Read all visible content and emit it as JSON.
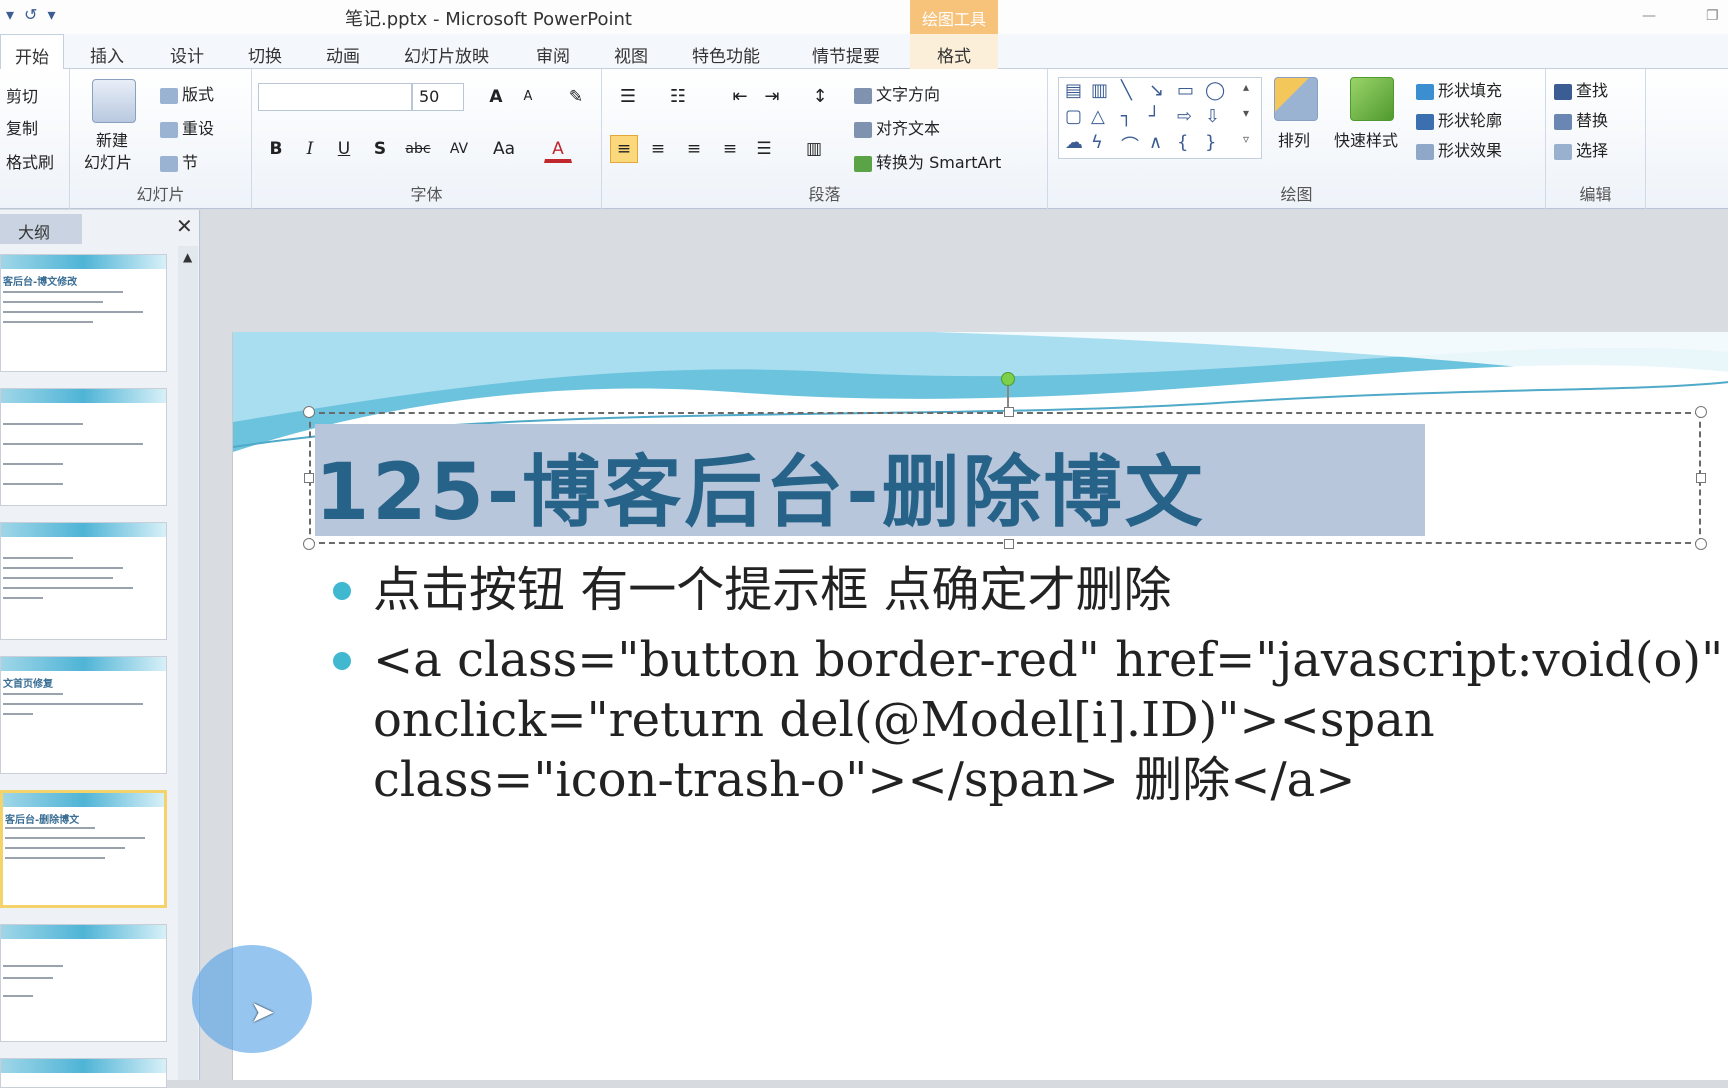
{
  "window": {
    "title": "笔记.pptx - Microsoft PowerPoint",
    "context_tab": "绘图工具",
    "qat_undo": "↺",
    "qat_menu": "▾",
    "minimize": "—",
    "restore": "❐"
  },
  "tabs": [
    "开始",
    "插入",
    "设计",
    "切换",
    "动画",
    "幻灯片放映",
    "审阅",
    "视图",
    "特色功能",
    "情节提要",
    "格式"
  ],
  "clipboard": {
    "cut": "剪切",
    "copy": "复制",
    "format_painter": "格式刷"
  },
  "slides_group": {
    "label": "幻灯片",
    "new_slide": "新建",
    "new_slide2": "幻灯片",
    "layout": "版式",
    "reset": "重设",
    "section": "节"
  },
  "font_group": {
    "label": "字体",
    "font_name": "",
    "font_size": "50",
    "bold": "B",
    "italic": "I",
    "underline": "U",
    "shadow": "S",
    "strike": "abc",
    "spacing": "AV",
    "case": "Aa",
    "color": "A",
    "grow": "A",
    "shrink": "A"
  },
  "paragraph_group": {
    "label": "段落",
    "text_direction": "文字方向",
    "align_text": "对齐文本",
    "smartart": "转换为 SmartArt"
  },
  "drawing_group": {
    "label": "绘图",
    "arrange": "排列",
    "quick_styles": "快速样式",
    "shape_fill": "形状填充",
    "shape_outline": "形状轮廓",
    "shape_effects": "形状效果"
  },
  "editing_group": {
    "label": "编辑",
    "find": "查找",
    "replace": "替换",
    "select": "选择"
  },
  "panel": {
    "tab": "大纲",
    "close": "✕"
  },
  "thumbnails": [
    {
      "title": "客后台-博文修改"
    },
    {
      "title": ""
    },
    {
      "title": ""
    },
    {
      "title": "文首页修复"
    },
    {
      "title": "客后台-删除博文"
    },
    {
      "title": ""
    }
  ],
  "slide": {
    "title": "125-博客后台-删除博文",
    "bullet1": "点击按钮 有一个提示框 点确定才删除",
    "bullet2_line1": "<a class=\"button border-red\" href=\"javascript:void(o)\"",
    "bullet2_line2": "onclick=\"return del(@Model[i].ID)\"><span",
    "bullet2_line3": "class=\"icon-trash-o\"></span> 删除</a>"
  },
  "colors": {
    "title": "#276389",
    "bullet": "#40b8d0",
    "selection": "#b8c6dc",
    "context_tab": "#f7c27a"
  }
}
